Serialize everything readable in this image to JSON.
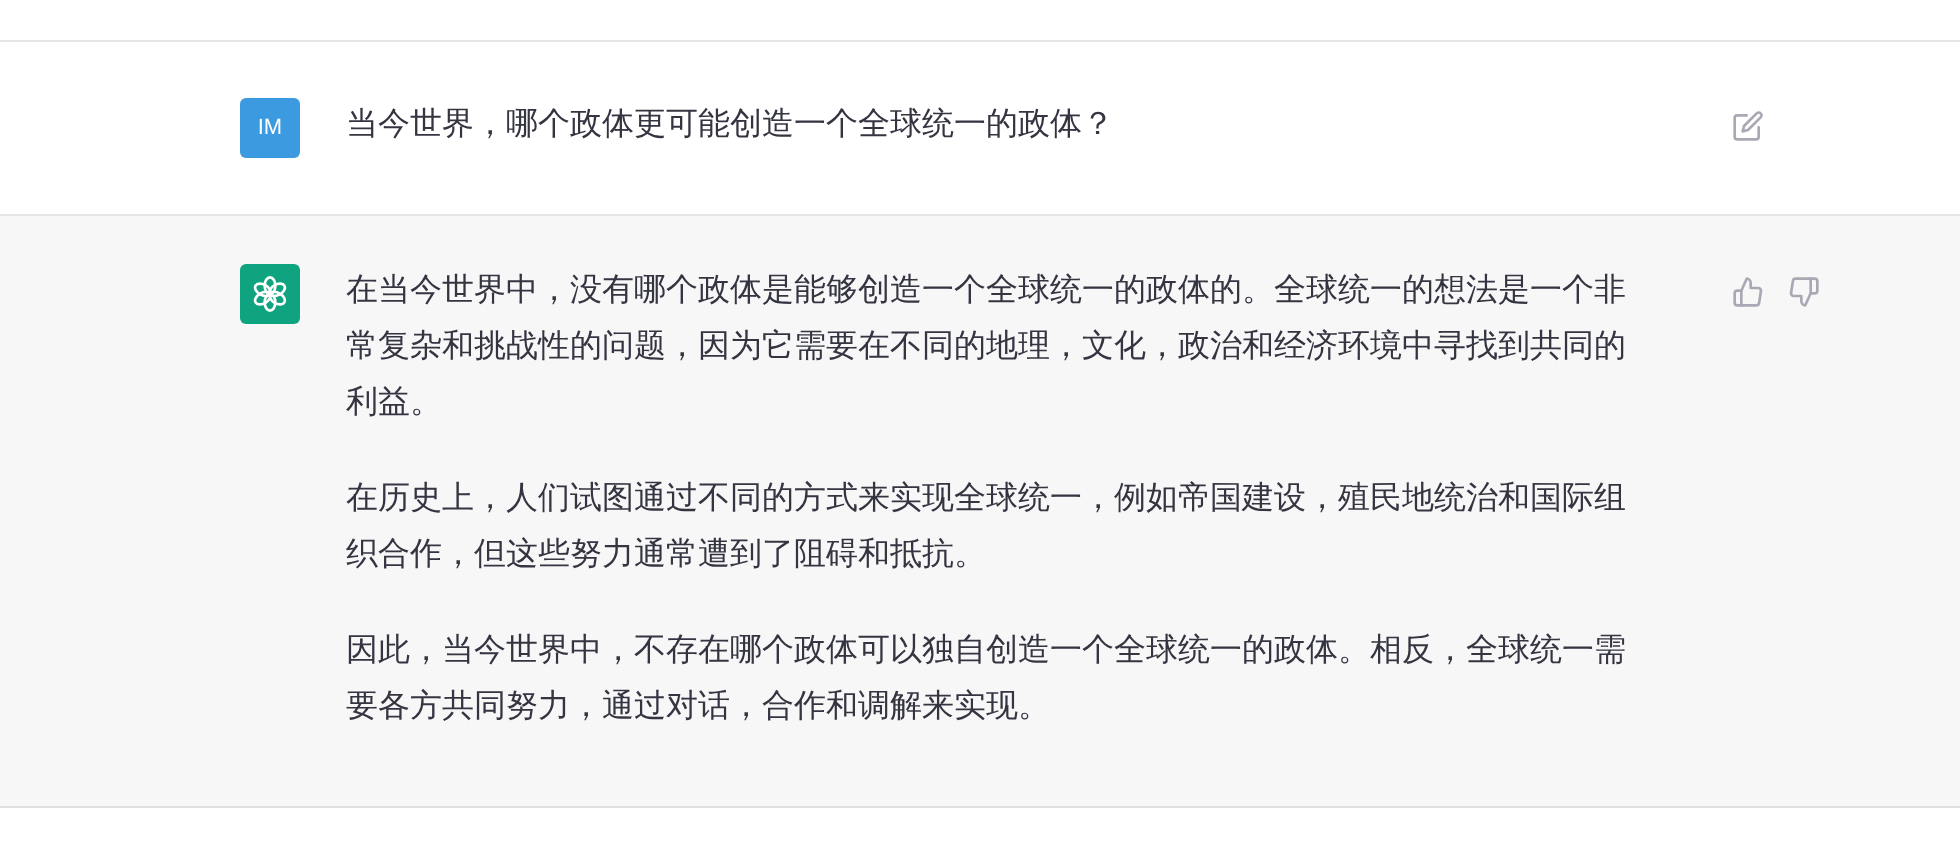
{
  "messages": [
    {
      "kind": "user",
      "avatar": "IM",
      "paragraphs": [
        "当今世界，哪个政体更可能创造一个全球统一的政体？"
      ]
    },
    {
      "kind": "assistant",
      "paragraphs": [
        "在当今世界中，没有哪个政体是能够创造一个全球统一的政体的。全球统一的想法是一个非常复杂和挑战性的问题，因为它需要在不同的地理，文化，政治和经济环境中寻找到共同的利益。",
        "在历史上，人们试图通过不同的方式来实现全球统一，例如帝国建设，殖民地统治和国际组织合作，但这些努力通常遭到了阻碍和抵抗。",
        "因此，当今世界中，不存在哪个政体可以独自创造一个全球统一的政体。相反，全球统一需要各方共同努力，通过对话，合作和调解来实现。"
      ]
    }
  ]
}
